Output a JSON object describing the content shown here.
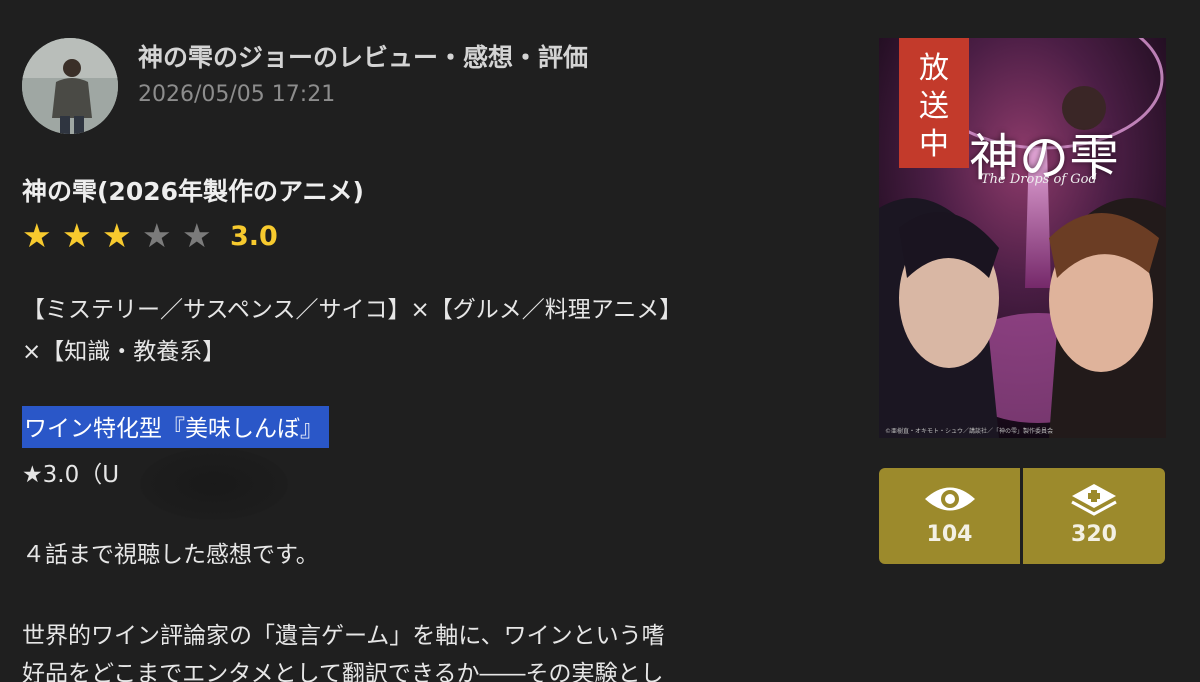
{
  "review": {
    "heading": "神の雫のジョーのレビュー・感想・評価",
    "date": "2026/05/05 17:21"
  },
  "anime": {
    "title": "神の雫(2026年製作のアニメ)",
    "rating": 3,
    "rating_max": 5,
    "rating_text": "3.0"
  },
  "body": {
    "genres_line1": "【ミステリー／サスペンス／サイコ】×【グルメ／料理アニメ】",
    "genres_line2": "×【知識・教養系】",
    "highlight": "ワイン特化型『美味しんぼ』",
    "score_line": "★3.0（U",
    "line_watched": "４話まで視聴した感想です。",
    "line_p1": "世界的ワイン評論家の「遺言ゲーム」を軸に、ワインという嗜",
    "line_p2": "好品をどこまでエンタメとして翻訳できるか――その実験とし"
  },
  "poster": {
    "badge": [
      "放",
      "送",
      "中"
    ],
    "title": "神の雫",
    "subtitle": "The Drops of God",
    "credit": "©亜樹直・オキモト・シュウ／講談社／「神の雫」製作委員会"
  },
  "stats": {
    "watched_count": "104",
    "want_count": "320"
  },
  "colors": {
    "background": "#1f1f1f",
    "star_on": "#f7ca2e",
    "star_off": "#7b7b7b",
    "stat_button": "#9c8a2c",
    "highlight": "#2a57c8",
    "badge": "#c33a2b"
  },
  "icons": {
    "watched": "eye-icon",
    "want": "plus-layers-icon"
  }
}
